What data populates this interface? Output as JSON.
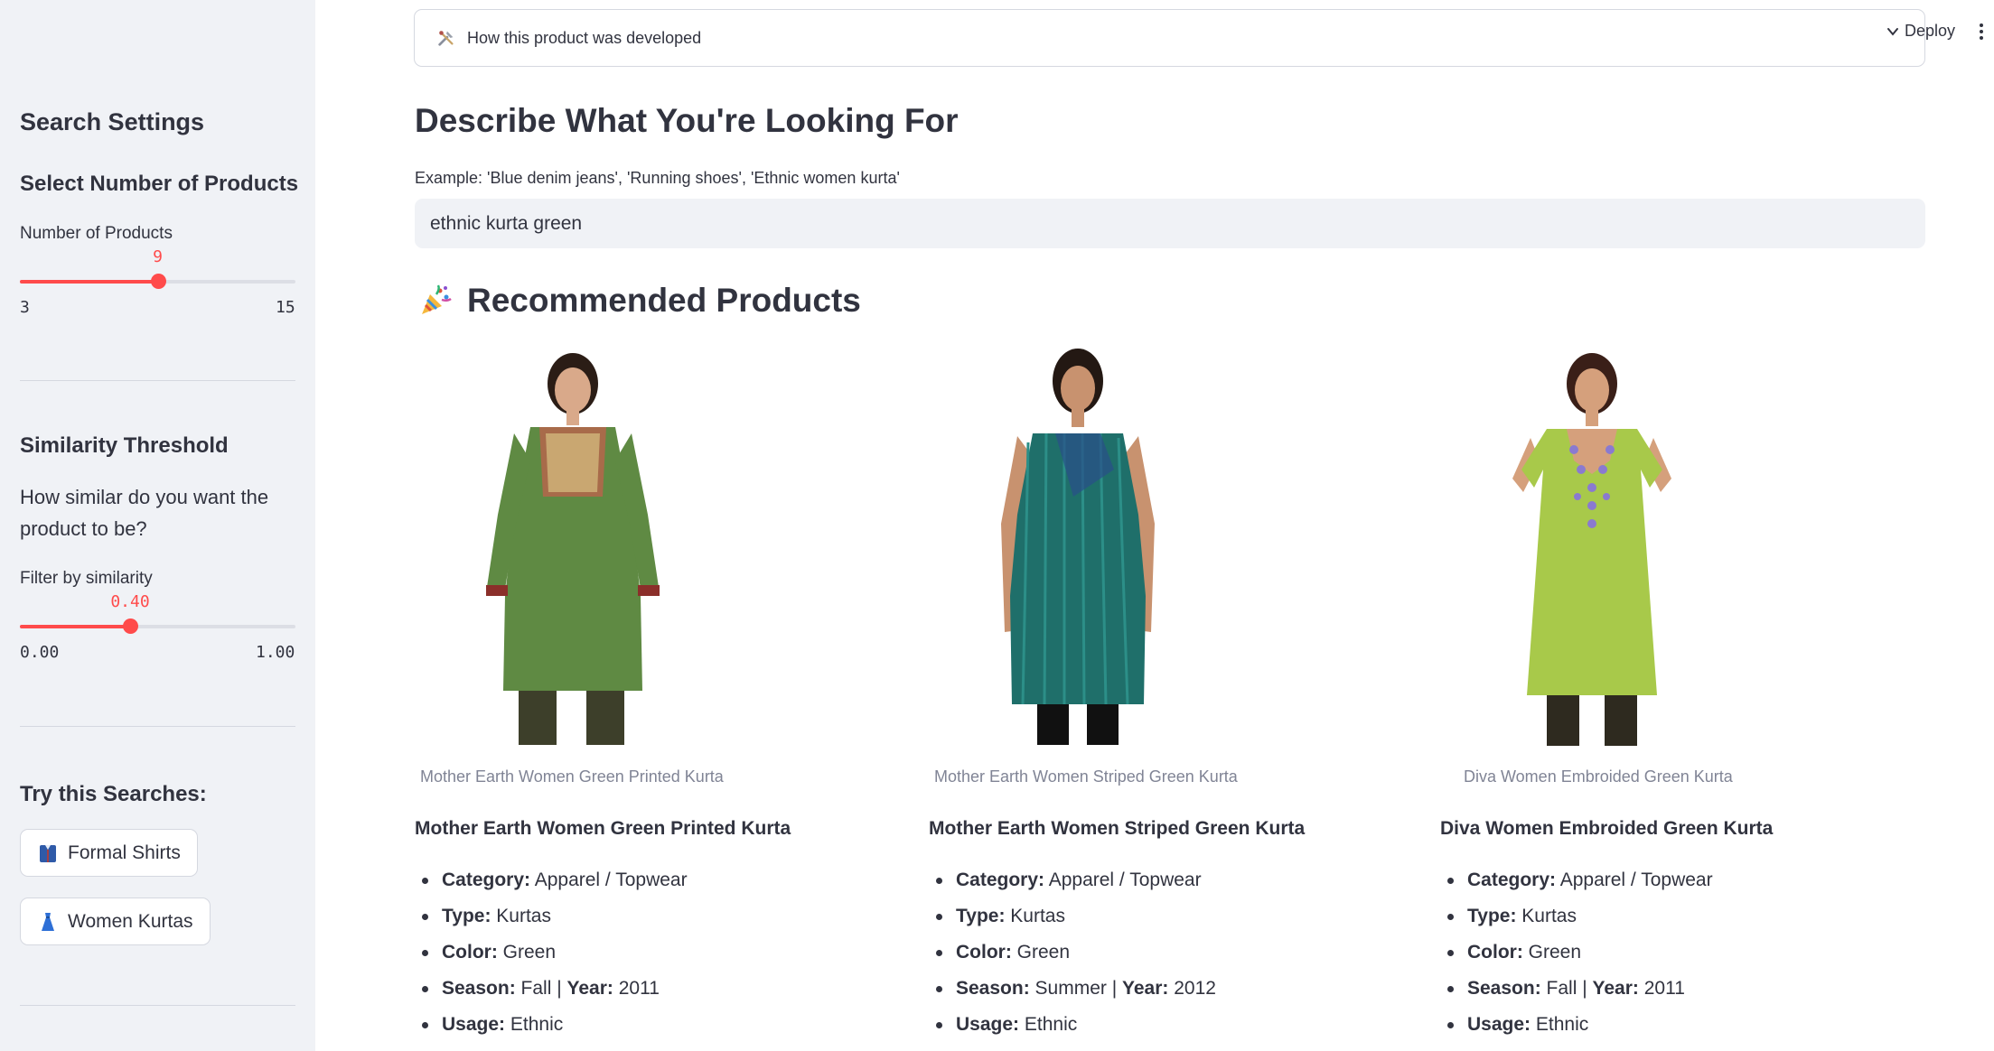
{
  "sidebar": {
    "title": "Search Settings",
    "num_products": {
      "heading": "Select Number of Products",
      "label": "Number of Products",
      "value": "9",
      "min": "3",
      "max": "15",
      "fraction": 0.5
    },
    "similarity": {
      "heading": "Similarity Threshold",
      "question": "How similar do you want the product to be?",
      "label": "Filter by similarity",
      "value": "0.40",
      "min": "0.00",
      "max": "1.00",
      "fraction": 0.4
    },
    "searches": {
      "heading": "Try this Searches:",
      "buttons": [
        {
          "label": "Formal Shirts",
          "icon": "shirt-emoji-icon"
        },
        {
          "label": "Women Kurtas",
          "icon": "dress-emoji-icon"
        }
      ]
    }
  },
  "header": {
    "expander_label": "How this product was developed",
    "deploy_label": "Deploy"
  },
  "main": {
    "title": "Describe What You're Looking For",
    "example": "Example: 'Blue denim jeans', 'Running shoes', 'Ethnic women kurta'",
    "search_value": "ethnic kurta green",
    "recommended_title": "Recommended Products"
  },
  "products": [
    {
      "caption": "Mother Earth Women Green Printed Kurta",
      "name": "Mother Earth Women Green Printed Kurta",
      "category": "Apparel / Topwear",
      "type": "Kurtas",
      "color": "Green",
      "season": "Fall",
      "year": "2011",
      "usage": "Ethnic"
    },
    {
      "caption": "Mother Earth Women Striped Green Kurta",
      "name": "Mother Earth Women Striped Green Kurta",
      "category": "Apparel / Topwear",
      "type": "Kurtas",
      "color": "Green",
      "season": "Summer",
      "year": "2012",
      "usage": "Ethnic"
    },
    {
      "caption": "Diva Women Embroided Green Kurta",
      "name": "Diva Women Embroided Green Kurta",
      "category": "Apparel / Topwear",
      "type": "Kurtas",
      "color": "Green",
      "season": "Fall",
      "year": "2011",
      "usage": "Ethnic"
    }
  ],
  "labels": {
    "category": "Category:",
    "type": "Type:",
    "color": "Color:",
    "season": "Season:",
    "year": "Year:",
    "usage": "Usage:",
    "sep": " | "
  },
  "colors": {
    "accent": "#ff4b4b",
    "sidebar_bg": "#f0f2f6",
    "text": "#31333f"
  }
}
